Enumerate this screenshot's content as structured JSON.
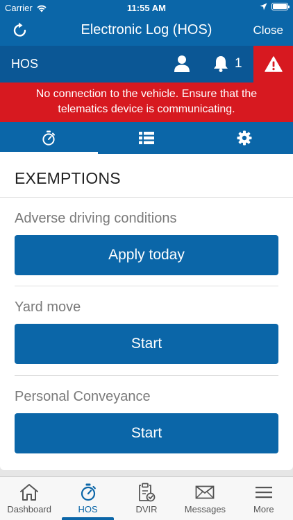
{
  "status_bar": {
    "carrier": "Carrier",
    "time": "11:55 AM"
  },
  "nav": {
    "title": "Electronic Log (HOS)",
    "close_label": "Close"
  },
  "hos_bar": {
    "label": "HOS",
    "notification_count": "1"
  },
  "banner": {
    "line1": "No connection to the vehicle. Ensure that the",
    "line2": "telematics device is communicating."
  },
  "tabs": [
    {
      "icon": "stopwatch-icon",
      "active": true
    },
    {
      "icon": "list-icon",
      "active": false
    },
    {
      "icon": "gear-icon",
      "active": false
    }
  ],
  "exemptions": {
    "heading": "EXEMPTIONS",
    "adverse": {
      "title": "Adverse driving conditions",
      "button": "Apply today"
    },
    "yard": {
      "title": "Yard move",
      "button": "Start"
    },
    "personal": {
      "title": "Personal Conveyance",
      "button": "Start"
    }
  },
  "tabbar": {
    "items": [
      {
        "label": "Dashboard",
        "icon": "house-icon"
      },
      {
        "label": "HOS",
        "icon": "stopwatch-icon",
        "active": true
      },
      {
        "label": "DVIR",
        "icon": "clipboard-check-icon"
      },
      {
        "label": "Messages",
        "icon": "envelope-icon"
      },
      {
        "label": "More",
        "icon": "hamburger-icon"
      }
    ]
  },
  "colors": {
    "primary": "#0b66a8",
    "dark": "#0b5795",
    "alert": "#d71920"
  }
}
